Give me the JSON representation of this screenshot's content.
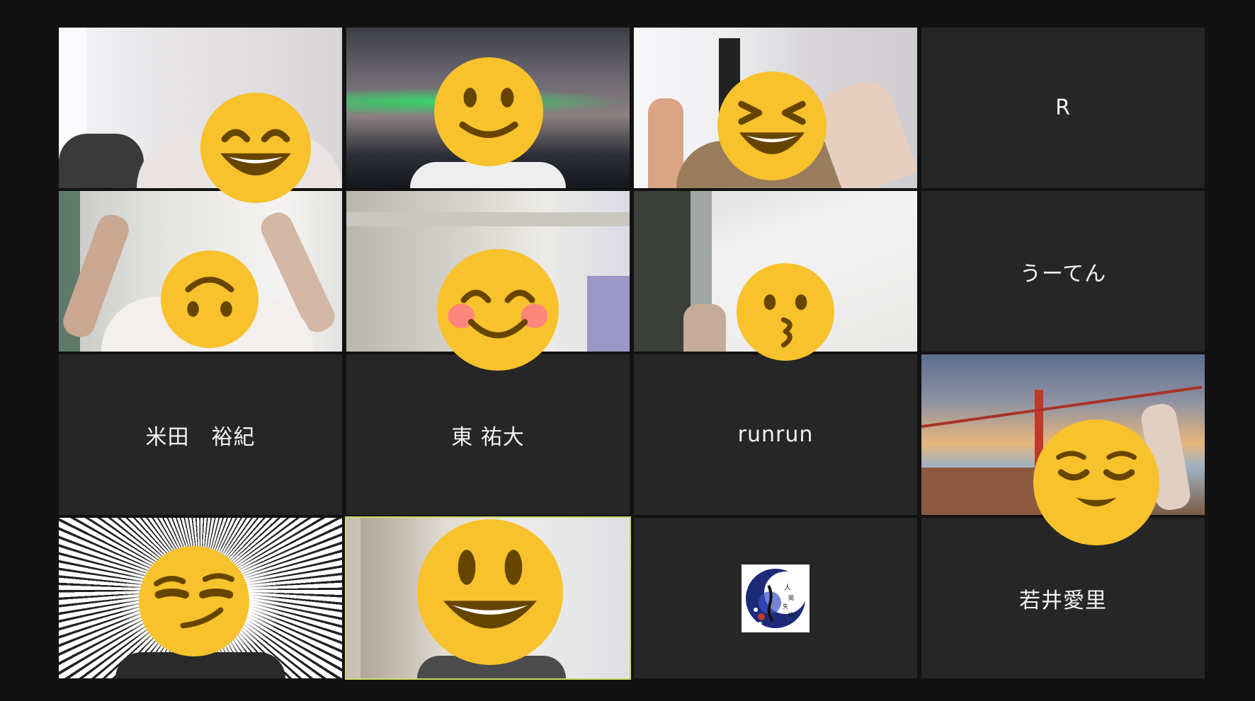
{
  "meeting": {
    "participants": [
      {
        "id": "p1",
        "name": "",
        "emoji": "grinning-squint-face-emoji",
        "bg": "room-white-wall"
      },
      {
        "id": "p2",
        "name": "",
        "emoji": "slightly-smiling-face-emoji",
        "bg": "aurora-night-sky"
      },
      {
        "id": "p3",
        "name": "",
        "emoji": "laughing-squint-face-emoji",
        "bg": "room-window-thumbs-up"
      },
      {
        "id": "p4",
        "name": "R",
        "emoji": "",
        "bg": "none"
      },
      {
        "id": "p5",
        "name": "",
        "emoji": "upside-down-face-emoji",
        "bg": "room-hands-up"
      },
      {
        "id": "p6",
        "name": "",
        "emoji": "blushing-smiling-face-emoji",
        "bg": "room-curtain"
      },
      {
        "id": "p7",
        "name": "",
        "emoji": "kissing-face-emoji",
        "bg": "room-ceiling-peace-sign"
      },
      {
        "id": "p8",
        "name": "うーてん",
        "emoji": "",
        "bg": "none"
      },
      {
        "id": "p9",
        "name": "米田　裕紀",
        "emoji": "",
        "bg": "none"
      },
      {
        "id": "p10",
        "name": "東 祐大",
        "emoji": "",
        "bg": "none"
      },
      {
        "id": "p11",
        "name": "runrun",
        "emoji": "",
        "bg": "none"
      },
      {
        "id": "p12",
        "name": "",
        "emoji": "relieved-face-emoji",
        "bg": "golden-gate-bridge-sunset"
      },
      {
        "id": "p13",
        "name": "",
        "emoji": "smirking-face-emoji",
        "bg": "manga-speed-lines"
      },
      {
        "id": "p14",
        "name": "",
        "emoji": "grinning-face-emoji",
        "bg": "blurred-room",
        "active": true
      },
      {
        "id": "p15",
        "name": "",
        "emoji": "",
        "bg": "profile-picture-logo"
      },
      {
        "id": "p16",
        "name": "若井愛里",
        "emoji": "",
        "bg": "none"
      }
    ]
  },
  "colors": {
    "background": "#121212",
    "tile": "#262626",
    "active_border": "#c8d86a",
    "emoji_yellow": "#f7c22b",
    "emoji_feature": "#664500"
  }
}
